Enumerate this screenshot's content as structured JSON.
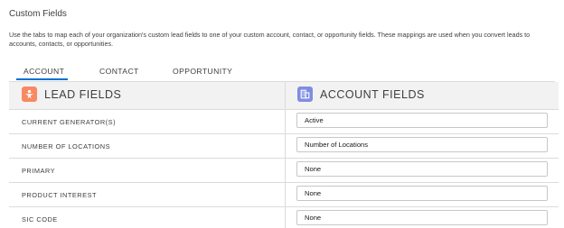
{
  "header": {
    "title": "Custom Fields",
    "description": "Use the tabs to map each of your organization's custom lead fields to one of your custom account, contact, or opportunity fields. These mappings are used when you convert leads to accounts, contacts, or opportunities."
  },
  "tabs": [
    {
      "label": "ACCOUNT",
      "active": true
    },
    {
      "label": "CONTACT",
      "active": false
    },
    {
      "label": "OPPORTUNITY",
      "active": false
    }
  ],
  "columns": {
    "left": {
      "label": "LEAD FIELDS",
      "icon": "lead-icon"
    },
    "right": {
      "label": "ACCOUNT FIELDS",
      "icon": "account-icon"
    }
  },
  "rows": [
    {
      "lead_field": "CURRENT GENERATOR(S)",
      "mapped_value": "Active"
    },
    {
      "lead_field": "NUMBER OF LOCATIONS",
      "mapped_value": "Number of Locations"
    },
    {
      "lead_field": "PRIMARY",
      "mapped_value": "None"
    },
    {
      "lead_field": "PRODUCT INTEREST",
      "mapped_value": "None"
    },
    {
      "lead_field": "SIC CODE",
      "mapped_value": "None"
    }
  ],
  "colors": {
    "accent": "#0070d2",
    "lead_icon": "#f88962",
    "account_icon": "#7f8de1"
  }
}
